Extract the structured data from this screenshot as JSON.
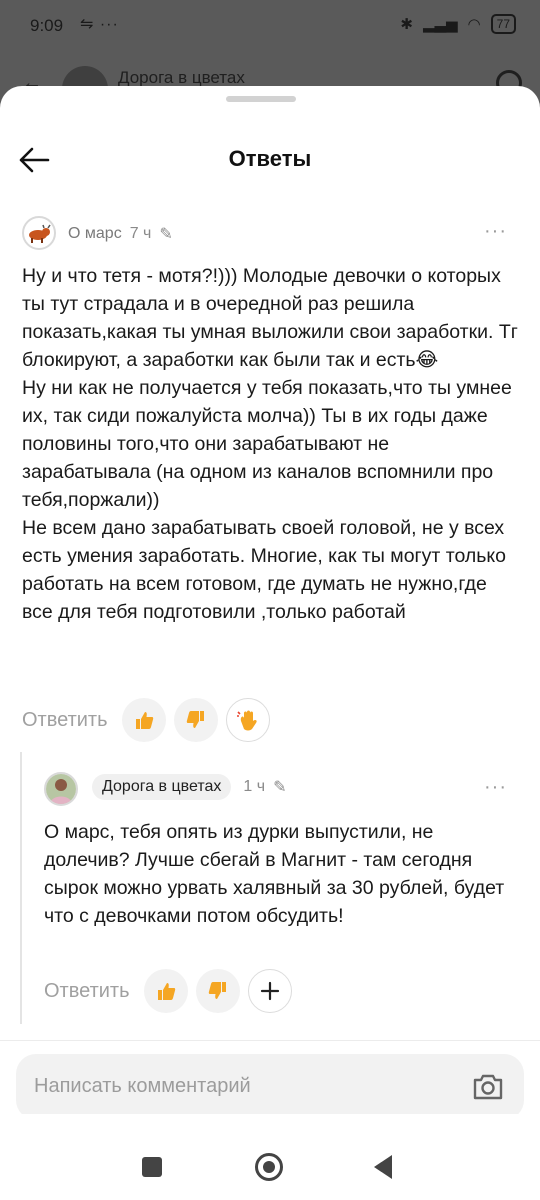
{
  "status_bar": {
    "time": "9:09",
    "extra": "⇋ ···",
    "battery": "77"
  },
  "background_page": {
    "title": "Дорога в цветах"
  },
  "sheet": {
    "title": "Ответы"
  },
  "comment": {
    "author": "О марс",
    "time": "7 ч",
    "text": "Ну и что тетя - мотя?!))) Молодые девочки о которых ты тут страдала и в очередной раз решила показать,какая ты умная выложили свои заработки. Тг блокируют, а заработки как были так и есть😂\nНу ни как не получается у тебя показать,что ты умнее их, так сиди пожалуйста молча)) Ты в их годы даже половины того,что они зарабатывают не зарабатывала (на одном из каналов вспомнили про тебя,поржали))\nНе всем дано зарабатывать своей головой, не у всех есть умения заработать. Многие, как ты могут только работать на всем готовом, где думать не нужно,где все для тебя подготовили ,только работай",
    "reply_label": "Ответить",
    "reactions": [
      "thumbs-up-icon",
      "thumbs-down-icon",
      "waving-hand-icon"
    ]
  },
  "reply": {
    "author": "Дорога в цветах",
    "time": "1 ч",
    "text": "О марс, тебя опять из дурки выпустили, не долечив? Лучше сбегай в Магнит - там сегодня сырок можно урвать халявный за 30 рублей, будет что с девочками потом обсудить!",
    "reply_label": "Ответить",
    "reactions": [
      "thumbs-up-icon",
      "thumbs-down-icon",
      "add-reaction-icon"
    ]
  },
  "composer": {
    "placeholder": "Написать комментарий"
  },
  "colors": {
    "accent_reaction": "#f5a623",
    "text": "#1a1a1a",
    "muted": "#9c9c9c"
  }
}
